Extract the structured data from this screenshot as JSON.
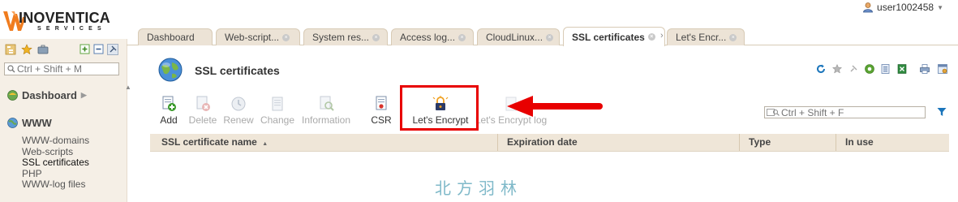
{
  "brand": {
    "name": "INOVENTICA",
    "sub": "SERVICES"
  },
  "user": {
    "name": "user1002458"
  },
  "sidebar": {
    "search_placeholder": "Ctrl + Shift + M",
    "groups": [
      {
        "label": "Dashboard"
      },
      {
        "label": "WWW"
      }
    ],
    "www_items": [
      "WWW-domains",
      "Web-scripts",
      "SSL certificates",
      "PHP",
      "WWW-log files"
    ]
  },
  "tabs": [
    {
      "label": "Dashboard"
    },
    {
      "label": "Web-script..."
    },
    {
      "label": "System res..."
    },
    {
      "label": "Access log..."
    },
    {
      "label": "CloudLinux..."
    },
    {
      "label": "SSL certificates"
    },
    {
      "label": "Let's Encr..."
    }
  ],
  "page": {
    "title": "SSL certificates"
  },
  "toolbar": {
    "add": "Add",
    "delete": "Delete",
    "renew": "Renew",
    "change": "Change",
    "information": "Information",
    "csr": "CSR",
    "letsencrypt": "Let's Encrypt",
    "letsencrypt_log": "Let's Encrypt log"
  },
  "filter": {
    "placeholder": "Ctrl + Shift + F"
  },
  "table": {
    "columns": [
      "SSL certificate name",
      "Expiration date",
      "Type",
      "In use"
    ],
    "sort_indicator": "▲"
  },
  "watermark": "北方羽林",
  "colors": {
    "highlight": "#e80000",
    "accent_blue": "#1b75bb",
    "header_bg": "#efe6d8"
  }
}
